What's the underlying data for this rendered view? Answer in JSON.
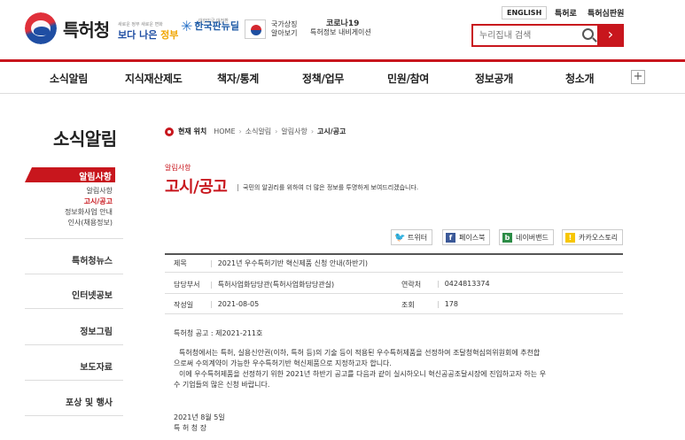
{
  "header": {
    "logo_text": "특허청",
    "banner1_small": "새로운 정부 새로운 변화",
    "banner1_main_a": "보다 나은 ",
    "banner1_main_b": "정부",
    "banner2_small": "대한민국 대전환",
    "banner2_main": "한국판뉴딜",
    "banner3_line1": "국가상징",
    "banner3_line2": "알아보기",
    "banner4_line1": "코로나19",
    "banner4_line2": "특허정보 내비게이션",
    "util_english": "ENGLISH",
    "util_1": "특허로",
    "util_2": "특허심판원",
    "search_placeholder": "누리집내 검색",
    "search_go": "›"
  },
  "gnb": [
    "소식알림",
    "지식재산제도",
    "책자/통계",
    "정책/업무",
    "민원/참여",
    "정보공개",
    "청소개"
  ],
  "gnb_more": "+",
  "sidebar": {
    "title": "소식알림",
    "active": "알림사항",
    "subs": [
      "알림사항",
      "고시/공고",
      "정보화사업 안내",
      "인사(채용정보)"
    ],
    "menus": [
      "특허청뉴스",
      "인터넷공보",
      "정보그림",
      "보도자료",
      "포상 및 행사"
    ]
  },
  "location": {
    "label": "현재 위치",
    "path": [
      "HOME",
      "소식알림",
      "알림사항"
    ],
    "current": "고시/공고"
  },
  "page": {
    "category": "알림사항",
    "title": "고시/공고",
    "desc": "국민의 알권리를 위하여 더 많은 정보를 투명하게 보여드리겠습니다."
  },
  "share": {
    "twitter": "트위터",
    "facebook": "페이스북",
    "naver": "네이버밴드",
    "kakao": "카카오스토리"
  },
  "post": {
    "subject_label": "제목",
    "subject": "2021년 우수특허기반 혁신제품 신청 안내(하반기)",
    "dept_label": "담당부서",
    "dept": "특허사업화담당관(특허사업화담당관실)",
    "contact_label": "연락처",
    "contact": "0424813374",
    "date_label": "작성일",
    "date": "2021-08-05",
    "views_label": "조회",
    "views": "178"
  },
  "body": {
    "notice_no": "특허청 공고 : 제2021-211호",
    "para1_l1": "특허청에서는 특허, 실용신안권(이하, 특허 등)의 기술 등이 적용된 우수특허제품을 선정하여 조달청혁심의위원회에 추천합",
    "para1_l2": "으로써 수의계약이 가능한 우수특허기반 혁신제품으로 지정하고자 합니다.",
    "para2_l1": "이에 우수특허제품을 선정하기 위한 2021년 하반기 공고를 다음과 같이 실시하오니 혁신공공조달시장에 진입하고자 하는 우",
    "para2_l2": "수 기업들의 많은 신청 바랍니다.",
    "sign_date": "2021년  8월  5일",
    "sign_name": "특 허 청 장"
  }
}
